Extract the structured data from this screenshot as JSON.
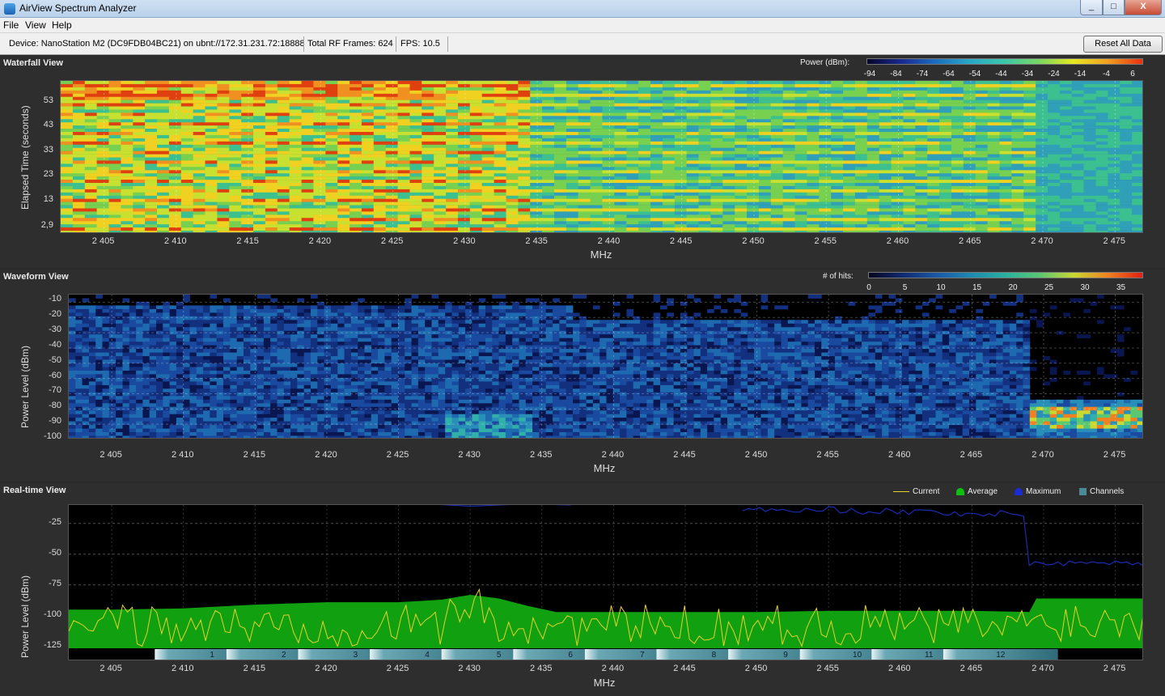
{
  "window": {
    "title": "AirView Spectrum Analyzer",
    "min_label": "_",
    "max_label": "□",
    "close_label": "X"
  },
  "menu": {
    "file": "File",
    "view": "View",
    "help": "Help"
  },
  "info": {
    "device": "Device: NanoStation M2 (DC9FDB04BC21) on ubnt://172.31.231.72:18888",
    "frames": "Total RF Frames: 624",
    "fps": "FPS: 10.5",
    "reset": "Reset All Data"
  },
  "x_ticks": [
    "2 405",
    "2 410",
    "2 415",
    "2 420",
    "2 425",
    "2 430",
    "2 435",
    "2 440",
    "2 445",
    "2 450",
    "2 455",
    "2 460",
    "2 465",
    "2 470",
    "2 475"
  ],
  "x_unit": "MHz",
  "waterfall": {
    "title": "Waterfall View",
    "ylabel": "Elapsed Time (seconds)",
    "y_ticks": [
      "53",
      "43",
      "33",
      "23",
      "13",
      "2,9"
    ],
    "scale_label": "Power (dBm):",
    "scale_ticks": [
      "-94",
      "-84",
      "-74",
      "-64",
      "-54",
      "-44",
      "-34",
      "-24",
      "-14",
      "-4",
      "6"
    ]
  },
  "waveform": {
    "title": "Waveform View",
    "ylabel": "Power Level (dBm)",
    "y_ticks": [
      "-10",
      "-20",
      "-30",
      "-40",
      "-50",
      "-60",
      "-70",
      "-80",
      "-90",
      "-100"
    ],
    "scale_label": "# of hits:",
    "scale_ticks": [
      "0",
      "5",
      "10",
      "15",
      "20",
      "25",
      "30",
      "35"
    ]
  },
  "realtime": {
    "title": "Real-time View",
    "ylabel": "Power Level (dBm)",
    "y_ticks": [
      "-25",
      "-50",
      "-75",
      "-100",
      "-125"
    ],
    "legend": {
      "current": "Current",
      "average": "Average",
      "maximum": "Maximum",
      "channels": "Channels"
    },
    "channels": [
      "1",
      "2",
      "3",
      "4",
      "5",
      "6",
      "7",
      "8",
      "9",
      "10",
      "11",
      "12"
    ]
  },
  "colors": {
    "average": "#10a010",
    "current": "#e6d22a",
    "maximum": "#1a2bb0",
    "channels": "#4a8a98"
  },
  "chart_data": [
    {
      "type": "heatmap",
      "title": "Waterfall View",
      "xlabel": "MHz",
      "ylabel": "Elapsed Time (seconds)",
      "xlim": [
        2402,
        2477
      ],
      "ylim": [
        0,
        60
      ],
      "y_ticks": [
        53,
        43,
        33,
        23,
        13,
        2.9
      ],
      "color_scale_dbm": [
        -94,
        6
      ]
    },
    {
      "type": "heatmap",
      "title": "Waveform View",
      "xlabel": "MHz",
      "ylabel": "Power Level (dBm)",
      "xlim": [
        2402,
        2477
      ],
      "ylim": [
        -100,
        -5
      ],
      "color_scale_hits": [
        0,
        38
      ]
    },
    {
      "type": "area",
      "title": "Real-time View",
      "xlabel": "MHz",
      "ylabel": "Power Level (dBm)",
      "xlim": [
        2402,
        2477
      ],
      "ylim": [
        -135,
        -10
      ],
      "series": [
        {
          "name": "Average",
          "x": [
            2402,
            2405,
            2410,
            2415,
            2420,
            2425,
            2428,
            2430,
            2432,
            2434,
            2436,
            2440,
            2445,
            2450,
            2455,
            2460,
            2465,
            2469,
            2469.5,
            2477
          ],
          "values": [
            -95,
            -95,
            -94,
            -91,
            -89,
            -89,
            -87,
            -83,
            -86,
            -92,
            -97,
            -97,
            -97,
            -97,
            -96,
            -96,
            -96,
            -97,
            -86,
            -86
          ]
        },
        {
          "name": "Maximum",
          "x": [
            2449,
            2455,
            2460,
            2465,
            2469,
            2469.5,
            2472,
            2477
          ],
          "values": [
            -10,
            -12,
            -14,
            -16,
            -17,
            -55,
            -56,
            -60
          ]
        }
      ],
      "channel_centers_mhz": [
        2412,
        2417,
        2422,
        2427,
        2432,
        2437,
        2442,
        2447,
        2452,
        2457,
        2462,
        2467
      ]
    }
  ]
}
